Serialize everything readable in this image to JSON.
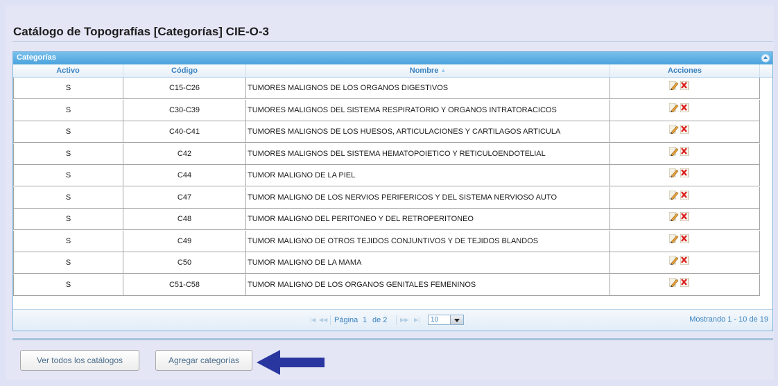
{
  "page": {
    "title": "Catálogo de Topografías [Categorías] CIE-O-3"
  },
  "grid": {
    "caption": "Categorías",
    "columns": [
      {
        "label": "Activo"
      },
      {
        "label": "Código"
      },
      {
        "label": "Nombre"
      },
      {
        "label": "Acciones"
      }
    ],
    "sort_column": "Nombre",
    "rows": [
      {
        "activo": "S",
        "codigo": "C15-C26",
        "nombre": "TUMORES MALIGNOS DE LOS ORGANOS DIGESTIVOS"
      },
      {
        "activo": "S",
        "codigo": "C30-C39",
        "nombre": "TUMORES MALIGNOS DEL SISTEMA RESPIRATORIO Y ORGANOS INTRATORACICOS"
      },
      {
        "activo": "S",
        "codigo": "C40-C41",
        "nombre": "TUMORES MALIGNOS DE LOS HUESOS, ARTICULACIONES Y CARTILAGOS ARTICULA"
      },
      {
        "activo": "S",
        "codigo": "C42",
        "nombre": "TUMORES MALIGNOS DEL SISTEMA HEMATOPOIETICO Y RETICULOENDOTELIAL"
      },
      {
        "activo": "S",
        "codigo": "C44",
        "nombre": "TUMOR MALIGNO DE LA PIEL"
      },
      {
        "activo": "S",
        "codigo": "C47",
        "nombre": "TUMOR MALIGNO DE LOS NERVIOS PERIFERICOS Y DEL SISTEMA NERVIOSO AUTO"
      },
      {
        "activo": "S",
        "codigo": "C48",
        "nombre": "TUMOR MALIGNO DEL PERITONEO Y DEL RETROPERITONEO"
      },
      {
        "activo": "S",
        "codigo": "C49",
        "nombre": "TUMOR MALIGNO DE OTROS TEJIDOS CONJUNTIVOS Y DE TEJIDOS BLANDOS"
      },
      {
        "activo": "S",
        "codigo": "C50",
        "nombre": "TUMOR MALIGNO DE LA MAMA"
      },
      {
        "activo": "S",
        "codigo": "C51-C58",
        "nombre": "TUMOR MALIGNO DE LOS ORGANOS GENITALES FEMENINOS"
      }
    ],
    "row_actions": {
      "edit_icon": "edit-pencil-icon",
      "delete_icon": "delete-icon"
    }
  },
  "pager": {
    "page_label": "Página",
    "current_page": "1",
    "of_label": "de 2",
    "page_size": "10",
    "records": "Mostrando 1 - 10 de 19"
  },
  "buttons": {
    "view_all": "Ver todos los catálogos",
    "add": "Agregar categorías"
  },
  "colors": {
    "accent": "#4aa2dc",
    "arrow": "#2a36a0",
    "background": "#dfe1f4"
  }
}
